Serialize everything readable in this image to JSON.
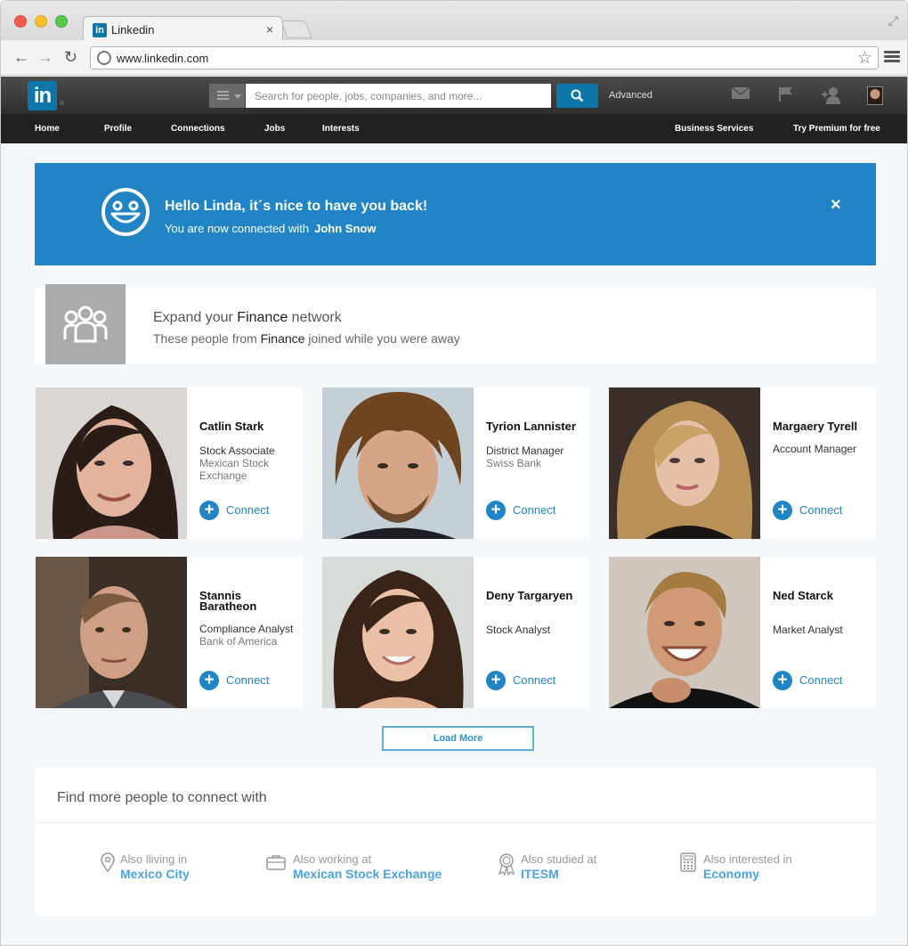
{
  "browser": {
    "tab_title": "Linkedin",
    "tab_close": "×",
    "url": "www.linkedin.com"
  },
  "header": {
    "logo_text": "in",
    "search_placeholder": "Search for people, jobs, companies, and more...",
    "advanced_label": "Advanced",
    "icons": [
      "mail-icon",
      "flag-icon",
      "add-connection-icon",
      "profile-avatar"
    ]
  },
  "nav": {
    "items": [
      "Home",
      "Profile",
      "Connections",
      "Jobs",
      "Interests"
    ],
    "right_items": [
      "Business Services",
      "Try Premium for free"
    ]
  },
  "banner": {
    "title": "Hello Linda, it´s nice to have you back!",
    "subtitle_prefix": "You are now connected with",
    "connected_name": "John Snow",
    "close": "×",
    "color": "#2185c5"
  },
  "expand": {
    "title_prefix": "Expand your",
    "title_highlight": "Finance",
    "title_suffix": "network",
    "sub_prefix": "These people from",
    "sub_highlight": "Finance",
    "sub_suffix": "joined while you were away"
  },
  "people": [
    {
      "name": "Catlin Stark",
      "title": "Stock Associate",
      "company": "Mexican Stock Exchange",
      "connect": "Connect"
    },
    {
      "name": "Tyrion Lannister",
      "title": "District Manager",
      "company": "Swiss Bank",
      "connect": "Connect"
    },
    {
      "name": "Margaery Tyrell",
      "title": "Account Manager",
      "company": "",
      "connect": "Connect"
    },
    {
      "name": "Stannis Baratheon",
      "title": "Compliance Analyst",
      "company": "Bank of America",
      "connect": "Connect"
    },
    {
      "name": "Deny Targaryen",
      "title": "Stock Analyst",
      "company": "",
      "connect": "Connect"
    },
    {
      "name": "Ned Starck",
      "title": "Market Analyst",
      "company": "",
      "connect": "Connect"
    }
  ],
  "load_more": "Load More",
  "find_more": {
    "title": "Find more people to connect with",
    "criteria": [
      {
        "icon": "location-pin-icon",
        "label": "Also lliving in",
        "value": "Mexico City"
      },
      {
        "icon": "briefcase-icon",
        "label": "Also working at",
        "value": "Mexican Stock Exchange"
      },
      {
        "icon": "award-ribbon-icon",
        "label": "Also studied at",
        "value": "ITESM"
      },
      {
        "icon": "calculator-icon",
        "label": "Also interested in",
        "value": "Economy"
      }
    ]
  }
}
